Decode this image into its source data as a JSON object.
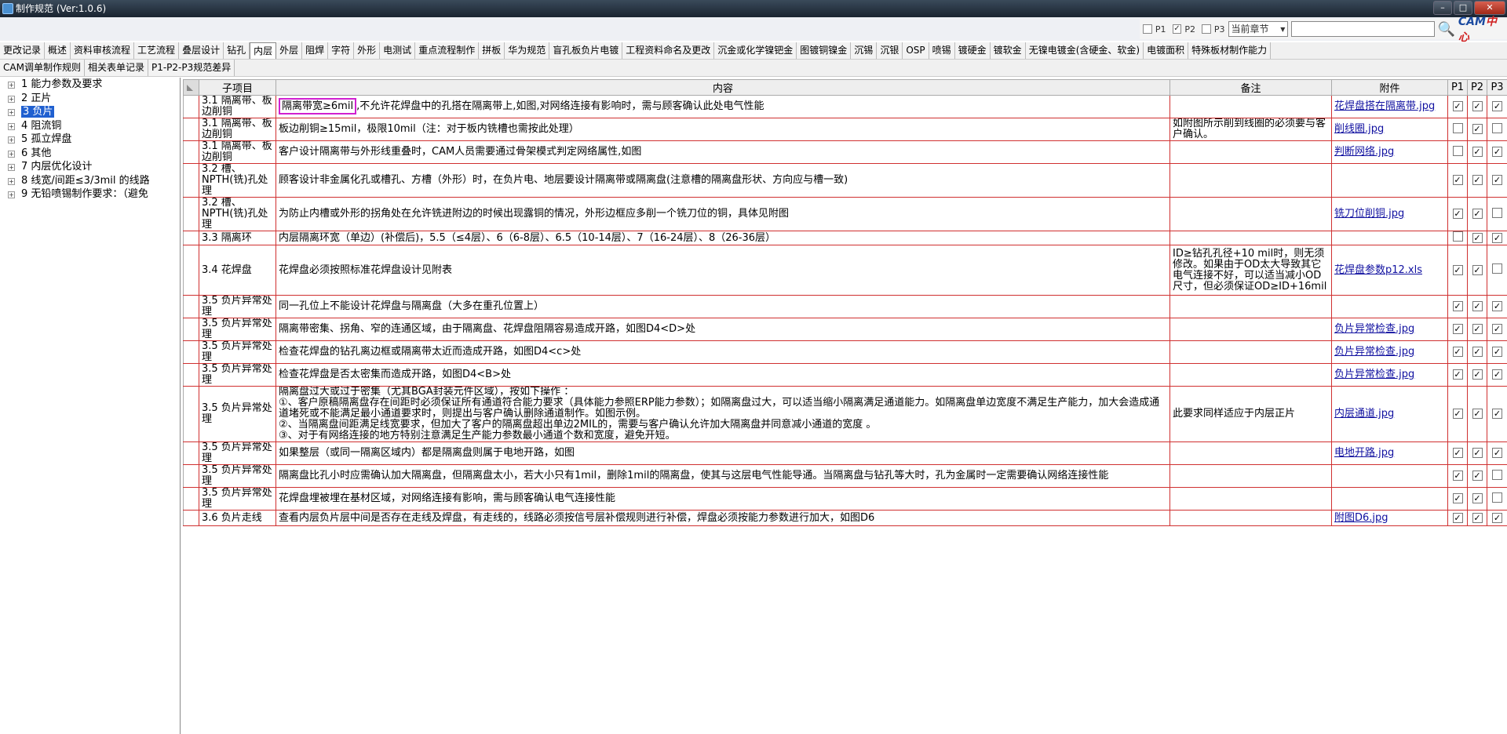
{
  "window": {
    "title": "制作规范 (Ver:1.0.6)"
  },
  "filter": {
    "p1": "P1",
    "p2": "P2",
    "p3": "P3",
    "p2_checked": "✓",
    "scope": "当前章节",
    "logo_a": "CAM",
    "logo_b": "中心"
  },
  "tabs_row1": [
    "更改记录",
    "概述",
    "资料审核流程",
    "工艺流程",
    "叠层设计",
    "钻孔",
    "内层",
    "外层",
    "阻焊",
    "字符",
    "外形",
    "电测试",
    "重点流程制作",
    "拼板",
    "华为规范",
    "盲孔板负片电镀",
    "工程资料命名及更改",
    "沉金或化学镍钯金",
    "图镀铜镍金",
    "沉锡",
    "沉银",
    "OSP",
    "喷锡",
    "镀硬金",
    "镀软金",
    "无镍电镀金(含硬金、软金)",
    "电镀面积",
    "特殊板材制作能力"
  ],
  "tabs_row2": [
    "CAM调单制作规则",
    "相关表单记录",
    "P1-P2-P3规范差异"
  ],
  "active_tab": "内层",
  "tree": [
    {
      "label": "1  能力参数及要求"
    },
    {
      "label": "2  正片"
    },
    {
      "label": "3  负片"
    },
    {
      "label": "4  阻流铜"
    },
    {
      "label": "5  孤立焊盘"
    },
    {
      "label": "6  其他"
    },
    {
      "label": "7  内层优化设计"
    },
    {
      "label": "8  线宽/间距≤3/3mil 的线路"
    },
    {
      "label": "9  无铅喷锡制作要求：（避免"
    }
  ],
  "table": {
    "headers": {
      "sub": "子项目",
      "content": "内容",
      "note": "备注",
      "att": "附件",
      "p1": "P1",
      "p2": "P2",
      "p3": "P3"
    },
    "rows": [
      {
        "sub": "3.1 隔离带、板边削铜",
        "content_hl": "隔离带宽≥6mil",
        "content": ",不允许花焊盘中的孔搭在隔离带上,如图,对网络连接有影响时，需与顾客确认此处电气性能",
        "note": "",
        "att": "花焊盘搭在隔离带.jpg",
        "p": [
          "✓",
          "✓",
          "✓"
        ]
      },
      {
        "sub": "3.1 隔离带、板边削铜",
        "content": "板边削铜≥15mil，极限10mil（注：对于板内铣槽也需按此处理）",
        "note": "如附图所示削到线圈的必须要与客户确认。",
        "att": "削线圈.jpg",
        "p": [
          "",
          "✓",
          ""
        ]
      },
      {
        "sub": "3.1 隔离带、板边削铜",
        "content": "客户设计隔离带与外形线重叠时，CAM人员需要通过骨架模式判定网络属性,如图",
        "note": "",
        "att": "判断网络.jpg",
        "p": [
          "",
          "✓",
          "✓"
        ]
      },
      {
        "sub": "3.2 槽、NPTH(铣)孔处理",
        "content": "顾客设计非金属化孔或槽孔、方槽（外形）时，在负片电、地层要设计隔离带或隔离盘(注意槽的隔离盘形状、方向应与槽一致)",
        "note": "",
        "att": "",
        "p": [
          "✓",
          "✓",
          "✓"
        ]
      },
      {
        "sub": "3.2 槽、NPTH(铣)孔处理",
        "content": "为防止内槽或外形的拐角处在允许铣进附边的时候出现露铜的情况，外形边框应多削一个铣刀位的铜，具体见附图",
        "note": "",
        "att": "铣刀位削铜.jpg",
        "p": [
          "✓",
          "✓",
          ""
        ]
      },
      {
        "sub": "3.3 隔离环",
        "content": "内层隔离环宽（单边）(补偿后)，5.5（≤4层）、6（6-8层）、6.5（10-14层）、7（16-24层）、8（26-36层）",
        "note": "",
        "att": "",
        "p": [
          "",
          "✓",
          "✓"
        ]
      },
      {
        "sub": "3.4 花焊盘",
        "content": "花焊盘必须按照标准花焊盘设计见附表",
        "note": "ID≥钻孔孔径+10 mil时，则无须修改。如果由于OD太大导致其它电气连接不好，可以适当减小OD尺寸，但必须保证OD≥ID+16mil",
        "att": "花焊盘参数p12.xls",
        "p": [
          "✓",
          "✓",
          ""
        ]
      },
      {
        "sub": "3.5 负片异常处理",
        "content": "同一孔位上不能设计花焊盘与隔离盘（大多在重孔位置上）",
        "note": "",
        "att": "",
        "p": [
          "✓",
          "✓",
          "✓"
        ]
      },
      {
        "sub": "3.5 负片异常处理",
        "content": "隔离带密集、拐角、窄的连通区域，由于隔离盘、花焊盘阻隔容易造成开路，如图D4<D>处",
        "note": "",
        "att": "负片异常检查.jpg",
        "p": [
          "✓",
          "✓",
          "✓"
        ]
      },
      {
        "sub": "3.5 负片异常处理",
        "content": "检查花焊盘的钻孔离边框或隔离带太近而造成开路，如图D4<c>处",
        "note": "",
        "att": "负片异常检查.jpg",
        "p": [
          "✓",
          "✓",
          "✓"
        ]
      },
      {
        "sub": "3.5 负片异常处理",
        "content": "检查花焊盘是否太密集而造成开路，如图D4<B>处",
        "note": "",
        "att": "负片异常检查.jpg",
        "p": [
          "✓",
          "✓",
          "✓"
        ]
      },
      {
        "sub": "3.5 负片异常处理",
        "content": "隔离盘过大或过于密集（尤其BGA封装元件区域），按如下操作 ：\n①、客户原稿隔离盘存在间距时必须保证所有通道符合能力要求（具体能力参照ERP能力参数）；如隔离盘过大，可以适当缩小隔离满足通道能力。如隔离盘单边宽度不满足生产能力，加大会造成通道堵死或不能满足最小通道要求时，则提出与客户确认删除通道制作。如图示例。\n②、当隔离盘间距满足线宽要求，但加大了客户的隔离盘超出单边2MIL的，需要与客户确认允许加大隔离盘并同意减小通道的宽度 。\n③、对于有网络连接的地方特别注意满足生产能力参数最小通道个数和宽度，避免开短。",
        "note": "此要求同样适应于内层正片",
        "att": "内层通道.jpg",
        "p": [
          "✓",
          "✓",
          "✓"
        ]
      },
      {
        "sub": "3.5 负片异常处理",
        "content": "如果整层（或同一隔离区域内）都是隔离盘则属于电地开路，如图",
        "note": "",
        "att": "电地开路.jpg",
        "p": [
          "✓",
          "✓",
          "✓"
        ]
      },
      {
        "sub": "3.5 负片异常处理",
        "content": "隔离盘比孔小时应需确认加大隔离盘，但隔离盘太小，若大小只有1mil，删除1mil的隔离盘，使其与这层电气性能导通。当隔离盘与钻孔等大时，孔为金属时一定需要确认网络连接性能",
        "note": "",
        "att": "",
        "p": [
          "✓",
          "✓",
          ""
        ]
      },
      {
        "sub": "3.5 负片异常处理",
        "content": "花焊盘埋被埋在基材区域，对网络连接有影响，需与顾客确认电气连接性能",
        "note": "",
        "att": "",
        "p": [
          "✓",
          "✓",
          ""
        ]
      },
      {
        "sub": "3.6 负片走线",
        "content": "查看内层负片层中间是否存在走线及焊盘，有走线的，线路必须按信号层补偿规则进行补偿，焊盘必须按能力参数进行加大，如图D6",
        "note": "",
        "att": "附图D6.jpg",
        "p": [
          "✓",
          "✓",
          "✓"
        ]
      }
    ]
  }
}
